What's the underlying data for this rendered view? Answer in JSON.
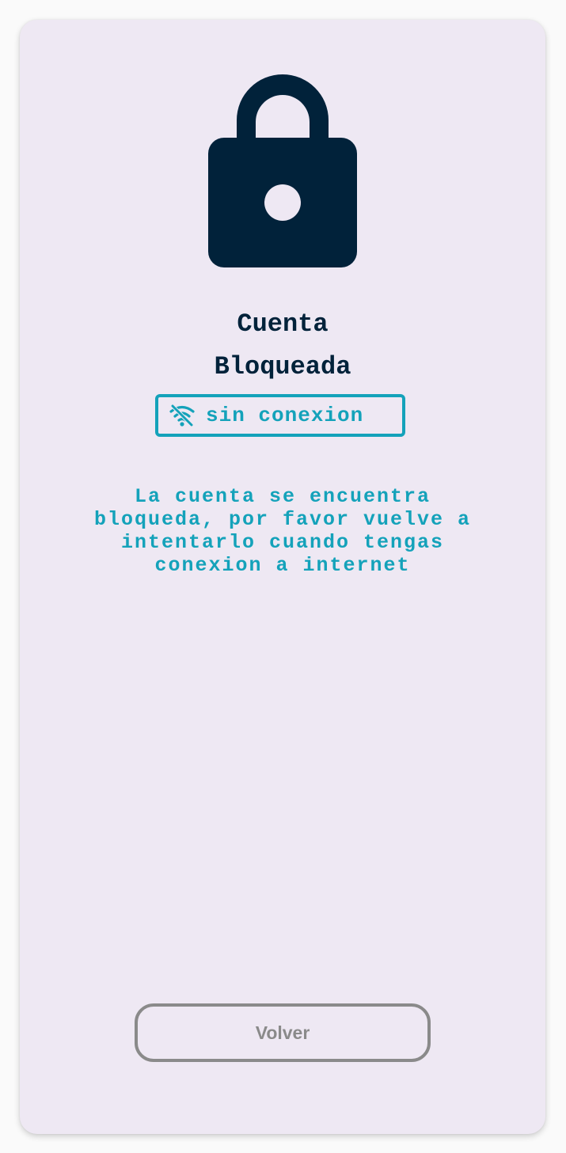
{
  "screen": {
    "title_line1": "Cuenta",
    "title_line2": "Bloqueada",
    "status_badge": {
      "icon": "wifi-off-icon",
      "label": "sin conexion"
    },
    "message_lines": [
      "La cuenta se encuentra",
      "bloqueda, por favor vuelve a",
      "intentarlo cuando tengas",
      "conexion a internet"
    ],
    "back_button_label": "Volver",
    "main_icon": "lock-icon"
  },
  "colors": {
    "background": "#eee8f3",
    "primary_dark": "#01223a",
    "accent_teal": "#14a2ba",
    "disabled_gray": "#8a8a8a"
  }
}
